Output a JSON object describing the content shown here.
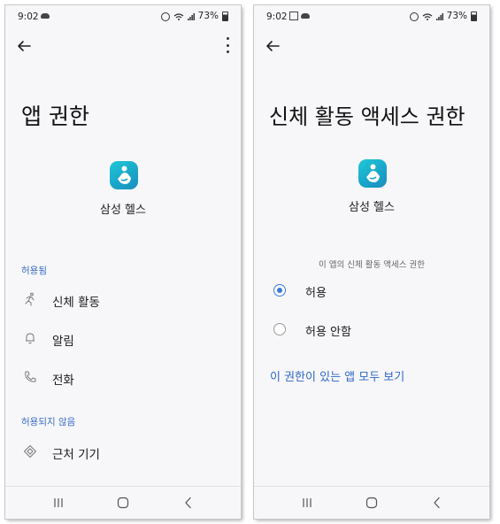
{
  "left_screen": {
    "status": {
      "time": "9:02",
      "battery": "73%"
    },
    "title": "앱 권한",
    "app_name": "삼성 헬스",
    "allowed_label": "허용됨",
    "allowed_items": [
      {
        "label": "신체 활동",
        "icon": "running-person-icon"
      },
      {
        "label": "알림",
        "icon": "bell-icon"
      },
      {
        "label": "전화",
        "icon": "phone-icon"
      }
    ],
    "denied_label": "허용되지 않음",
    "denied_items": [
      {
        "label": "근처 기기",
        "icon": "nearby-devices-icon"
      }
    ]
  },
  "right_screen": {
    "status": {
      "time": "9:02",
      "battery": "73%"
    },
    "title": "신체 활동 액세스 권한",
    "app_name": "삼성 헬스",
    "description": "이 앱의 신체 활동 액세스 권한",
    "options": [
      {
        "label": "허용",
        "selected": true
      },
      {
        "label": "허용 안함",
        "selected": false
      }
    ],
    "link": "이 권한이 있는 앱 모두 보기"
  },
  "colors": {
    "accent": "#3a78e0",
    "link": "#2f67c7",
    "section": "#3a6bc4",
    "background": "#f7f7f9"
  }
}
